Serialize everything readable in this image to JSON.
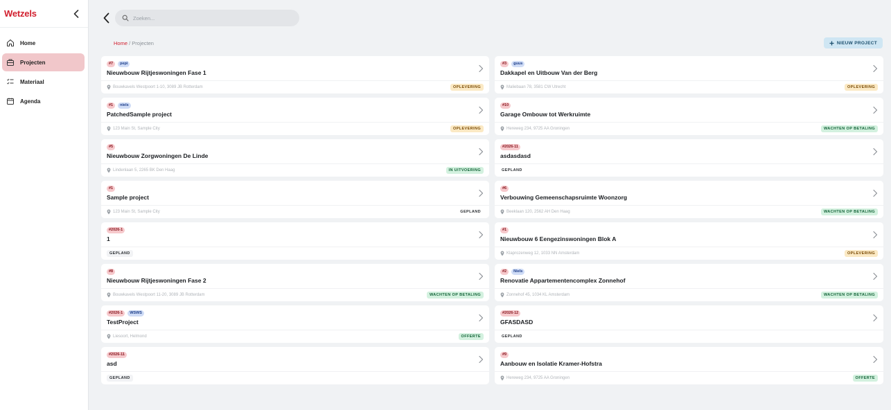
{
  "brand": "Wetzels",
  "nav": [
    {
      "key": "home",
      "label": "Home",
      "icon": "home-icon",
      "active": false
    },
    {
      "key": "projecten",
      "label": "Projecten",
      "icon": "briefcase-icon",
      "active": true
    },
    {
      "key": "materiaal",
      "label": "Materiaal",
      "icon": "checklist-icon",
      "active": false
    },
    {
      "key": "agenda",
      "label": "Agenda",
      "icon": "calendar-icon",
      "active": false
    }
  ],
  "search": {
    "placeholder": "Zoeken..."
  },
  "breadcrumb": {
    "home": "Home",
    "separator": " / ",
    "current": "Projecten"
  },
  "new_project_label": "NIEUW PROJECT",
  "colors": {
    "brand_red": "#d11f2e",
    "active_nav": "#f1c7ca"
  },
  "projects": [
    {
      "num": "#7",
      "user": "pepi",
      "title": "Nieuwbouw Rijtjeswoningen Fase 1",
      "address": "Bouwkavels Westpoort 1-10, 3089 JB Rotterdam",
      "status": "OPLEVERING",
      "status_kind": "oplevering"
    },
    {
      "num": "#3",
      "user": "guus",
      "title": "Dakkapel en Uitbouw Van der Berg",
      "address": "Maliebaan 78, 3581 CW Utrecht",
      "status": "OPLEVERING",
      "status_kind": "oplevering"
    },
    {
      "num": "#1",
      "user": "niels",
      "title": "PatchedSample project",
      "address": "123 Main St, Sample City",
      "status": "OPLEVERING",
      "status_kind": "oplevering"
    },
    {
      "num": "#10",
      "user": "",
      "title": "Garage Ombouw tot Werkruimte",
      "address": "Hereweg 234, 9725 AA Groningen",
      "status": "WACHTEN OP BETALING",
      "status_kind": "wachten"
    },
    {
      "num": "#5",
      "user": "",
      "title": "Nieuwbouw Zorgwoningen De Linde",
      "address": "Lindenlaan 5, 2265 BK Den Haag",
      "status": "IN UITVOERING",
      "status_kind": "uitvoering"
    },
    {
      "num": "#2026-11",
      "user": "",
      "title": "asdasdasd",
      "address": "",
      "status": "GEPLAND",
      "status_kind": "plain"
    },
    {
      "num": "#1",
      "user": "",
      "title": "Sample project",
      "address": "123 Main St, Sample City",
      "status": "GEPLAND",
      "status_kind": "plain"
    },
    {
      "num": "#6",
      "user": "",
      "title": "Verbouwing Gemeenschapsruimte Woonzorg",
      "address": "Beeklaan 120, 2562 AH Den Haag",
      "status": "WACHTEN OP BETALING",
      "status_kind": "wachten"
    },
    {
      "num": "#2026-1",
      "user": "",
      "title": "1",
      "address": "",
      "status": "GEPLAND",
      "status_kind": "gepland"
    },
    {
      "num": "#1",
      "user": "",
      "title": "Nieuwbouw 6 Eengezinswoningen Blok A",
      "address": "Klaprozenweg 12, 1033 NN Amsterdam",
      "status": "OPLEVERING",
      "status_kind": "oplevering"
    },
    {
      "num": "#8",
      "user": "",
      "title": "Nieuwbouw Rijtjeswoningen Fase 2",
      "address": "Bouwkavels Westpoort 11-20, 3089 JB Rotterdam",
      "status": "WACHTEN OP BETALING",
      "status_kind": "wachten"
    },
    {
      "num": "#2",
      "user": "Niels",
      "title": "Renovatie Appartementencomplex Zonnehof",
      "address": "Zonnehof 45, 1034 KL Amsterdam",
      "status": "WACHTEN OP BETALING",
      "status_kind": "wachten"
    },
    {
      "num": "#2026-1",
      "user": "WSWS",
      "title": "TestProject",
      "address": "Liesoort, Helmond",
      "status": "OFFERTE",
      "status_kind": "offerte"
    },
    {
      "num": "#2026-12",
      "user": "",
      "title": "GFASDASD",
      "address": "",
      "status": "GEPLAND",
      "status_kind": "plain"
    },
    {
      "num": "#2026-11",
      "user": "",
      "title": "asd",
      "address": "",
      "status": "GEPLAND",
      "status_kind": "gepland"
    },
    {
      "num": "#9",
      "user": "",
      "title": "Aanbouw en Isolatie Kramer-Hofstra",
      "address": "Hereweg 234, 9725 AA Groningen",
      "status": "OFFERTE",
      "status_kind": "offerte"
    }
  ]
}
